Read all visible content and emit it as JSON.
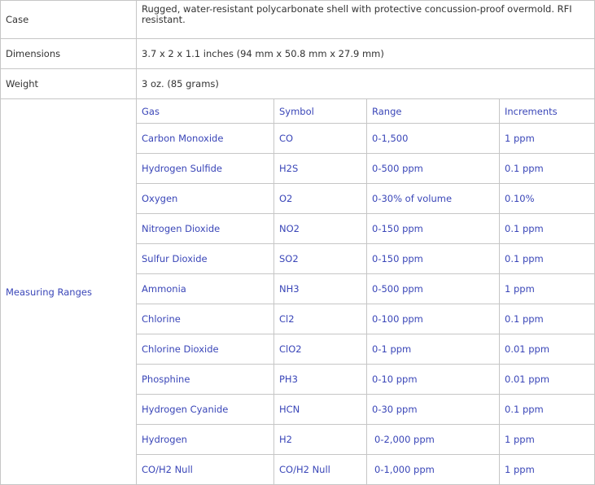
{
  "spec": {
    "case": {
      "label": "Case",
      "value": "Rugged, water-resistant polycarbonate shell with protective concussion-proof overmold. RFI resistant."
    },
    "dimensions": {
      "label": "Dimensions",
      "value": "3.7 x 2 x 1.1 inches (94 mm x 50.8 mm x 27.9 mm)"
    },
    "weight": {
      "label": "Weight",
      "value": "3 oz. (85 grams)"
    },
    "measuring_ranges": {
      "label": "Measuring Ranges",
      "headers": [
        "Gas",
        "Symbol",
        "Range",
        "Increments"
      ],
      "rows": [
        {
          "gas": "Carbon Monoxide",
          "symbol": "CO",
          "range": "0-1,500",
          "increments": "1 ppm"
        },
        {
          "gas": "Hydrogen Sulfide",
          "symbol": "H2S",
          "range": "0-500 ppm",
          "increments": "0.1 ppm"
        },
        {
          "gas": "Oxygen",
          "symbol": "O2",
          "range": "0-30% of volume",
          "increments": "0.10%"
        },
        {
          "gas": "Nitrogen Dioxide",
          "symbol": "NO2",
          "range": "0-150 ppm",
          "increments": "0.1 ppm"
        },
        {
          "gas": "Sulfur Dioxide",
          "symbol": "SO2",
          "range": "0-150 ppm",
          "increments": "0.1 ppm"
        },
        {
          "gas": "Ammonia",
          "symbol": "NH3",
          "range": "0-500 ppm",
          "increments": "1 ppm"
        },
        {
          "gas": "Chlorine",
          "symbol": "Cl2",
          "range": "0-100 ppm",
          "increments": "0.1 ppm"
        },
        {
          "gas": "Chlorine Dioxide",
          "symbol": "ClO2",
          "range": "0-1 ppm",
          "increments": "0.01 ppm"
        },
        {
          "gas": "Phosphine",
          "symbol": "PH3",
          "range": "0-10 ppm",
          "increments": "0.01 ppm"
        },
        {
          "gas": "Hydrogen Cyanide",
          "symbol": "HCN",
          "range": "0-30 ppm",
          "increments": "0.1 ppm"
        },
        {
          "gas": "Hydrogen",
          "symbol": "H2",
          "range": "0-2,000 ppm",
          "increments": "1 ppm"
        },
        {
          "gas": "CO/H2 Null",
          "symbol": "CO/H2 Null",
          "range": "0-1,000 ppm",
          "increments": "1 ppm"
        }
      ]
    }
  },
  "colors": {
    "link_blue": "#3a46b8",
    "text": "#333333",
    "border": "#c6c6c6"
  }
}
